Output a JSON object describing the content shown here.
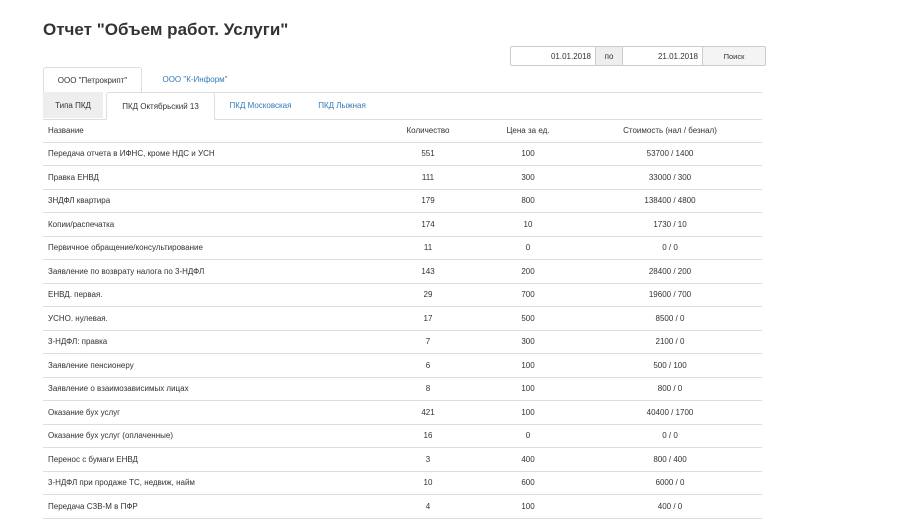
{
  "page_title": "Отчет \"Объем работ. Услуги\"",
  "filters": {
    "date_from": "01.01.2018",
    "separator": "по",
    "date_to": "21.01.2018",
    "search_label": "Поиск"
  },
  "company_tabs": [
    {
      "label": "ООО \"Петрокрипт\"",
      "active": true
    },
    {
      "label": "ООО \"К-Информ\"",
      "active": false
    }
  ],
  "pkd_tabs": [
    {
      "label": "Типа ПКД",
      "active": false
    },
    {
      "label": "ПКД Октябрьский 13",
      "active": true
    },
    {
      "label": "ПКД Московская",
      "active": false
    },
    {
      "label": "ПКД Лыжная",
      "active": false
    }
  ],
  "table": {
    "headers": [
      "Название",
      "Количество",
      "Цена за ед.",
      "Стоимость (нал / безнал)"
    ],
    "rows": [
      [
        "Передача отчета в ИФНС, кроме НДС и УСН",
        "551",
        "100",
        "53700 / 1400"
      ],
      [
        "Правка ЕНВД",
        "111",
        "300",
        "33000 / 300"
      ],
      [
        "3НДФЛ квартира",
        "179",
        "800",
        "138400 / 4800"
      ],
      [
        "Копии/распечатка",
        "174",
        "10",
        "1730 / 10"
      ],
      [
        "Первичное обращение/консультирование",
        "11",
        "0",
        "0 / 0"
      ],
      [
        "Заявление по возврату налога по 3-НДФЛ",
        "143",
        "200",
        "28400 / 200"
      ],
      [
        "ЕНВД. первая.",
        "29",
        "700",
        "19600 / 700"
      ],
      [
        "УСНО. нулевая.",
        "17",
        "500",
        "8500 / 0"
      ],
      [
        "3-НДФЛ: правка",
        "7",
        "300",
        "2100 / 0"
      ],
      [
        "Заявление пенсионеру",
        "6",
        "100",
        "500 / 100"
      ],
      [
        "Заявление о взаимозависимых лицах",
        "8",
        "100",
        "800 / 0"
      ],
      [
        "Оказание бух услуг",
        "421",
        "100",
        "40400 / 1700"
      ],
      [
        "Оказание бух услуг (оплаченные)",
        "16",
        "0",
        "0 / 0"
      ],
      [
        "Перенос с бумаги ЕНВД",
        "3",
        "400",
        "800 / 400"
      ],
      [
        "3-НДФЛ при продаже ТС, недвиж, найм",
        "10",
        "600",
        "6000 / 0"
      ],
      [
        "Передача СЗВ-М в ПФР",
        "4",
        "100",
        "400 / 0"
      ]
    ]
  }
}
